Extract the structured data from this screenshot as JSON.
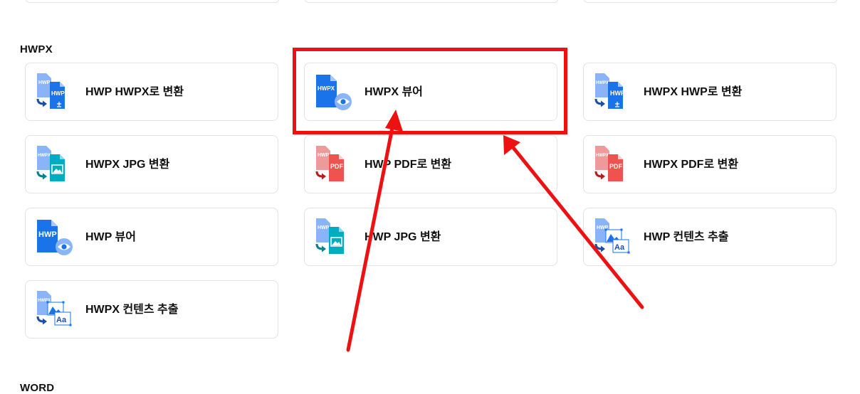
{
  "sections": {
    "hwpx": {
      "title": "HWPX"
    },
    "word": {
      "title": "WORD"
    }
  },
  "cards": [
    {
      "label": "HWP HWPX로 변환",
      "icon": "hwp-to-hwpx-convert-icon",
      "src_text": "HWP",
      "dst_text": "HWPX",
      "dst_color": "#1a73e8"
    },
    {
      "label": "HWPX 뷰어",
      "icon": "hwpx-viewer-icon",
      "doc_text": "HWPX"
    },
    {
      "label": "HWPX HWP로 변환",
      "icon": "hwpx-to-hwp-convert-icon",
      "src_text": "HWPX",
      "dst_text": "HWP",
      "dst_color": "#1a73e8"
    },
    {
      "label": "HWPX JPG 변환",
      "icon": "hwpx-to-jpg-convert-icon",
      "src_text": "HWPX"
    },
    {
      "label": "HWP PDF로 변환",
      "icon": "hwp-to-pdf-convert-icon",
      "src_text": "HWP",
      "dst_text": "PDF"
    },
    {
      "label": "HWPX PDF로 변환",
      "icon": "hwpx-to-pdf-convert-icon",
      "src_text": "HWPX",
      "dst_text": "PDF"
    },
    {
      "label": "HWP 뷰어",
      "icon": "hwp-viewer-icon",
      "doc_text": "HWP"
    },
    {
      "label": "HWP JPG 변환",
      "icon": "hwp-to-jpg-convert-icon",
      "src_text": "HWP"
    },
    {
      "label": "HWP 컨텐츠 추출",
      "icon": "hwp-content-extract-icon",
      "src_text": "HWP",
      "extract_text": "Aa"
    },
    {
      "label": "HWPX 컨텐츠 추출",
      "icon": "hwpx-content-extract-icon",
      "src_text": "HWPX",
      "extract_text": "Aa"
    }
  ],
  "colors": {
    "accent_blue": "#1a73e8",
    "light_blue": "#8ab4f8",
    "pdf_red": "#ef5350",
    "jpg_teal": "#00acc1",
    "highlight_red": "#ee1111",
    "card_border": "#e3e3e3"
  }
}
